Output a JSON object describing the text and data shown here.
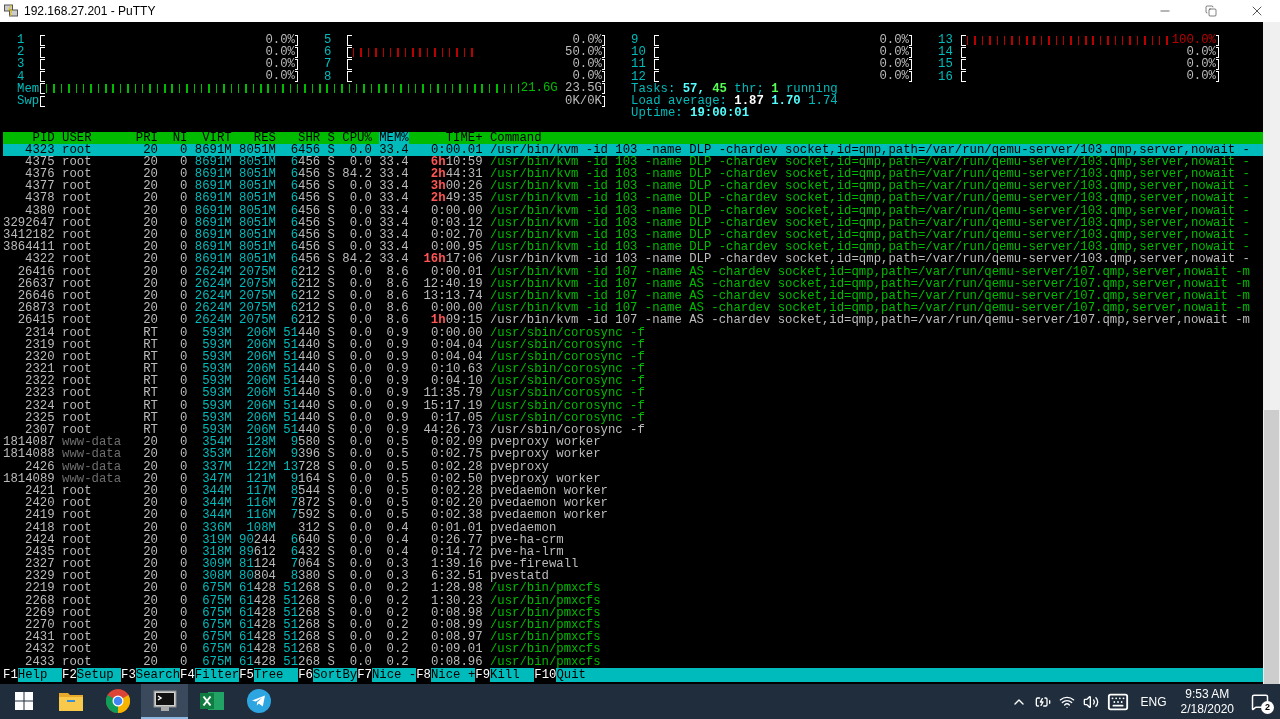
{
  "window": {
    "title": "192.168.27.201 - PuTTY"
  },
  "cpu_meters": [
    {
      "label": "1",
      "level": 0,
      "reading": "0.0%"
    },
    {
      "label": "2",
      "level": 0,
      "reading": "0.0%"
    },
    {
      "label": "3",
      "level": 0,
      "reading": "0.0%"
    },
    {
      "label": "4",
      "level": 0,
      "reading": "0.0%"
    },
    {
      "label": "5",
      "level": 0,
      "reading": "0.0%"
    },
    {
      "label": "6",
      "level": 0.5,
      "reading": "50.0%"
    },
    {
      "label": "7",
      "level": 0,
      "reading": "0.0%"
    },
    {
      "label": "8",
      "level": 0,
      "reading": "0.0%"
    },
    {
      "label": "9",
      "level": 0,
      "reading": "0.0%"
    },
    {
      "label": "10",
      "level": 0,
      "reading": "0.0%"
    },
    {
      "label": "11",
      "level": 0,
      "reading": "0.0%"
    },
    {
      "label": "12",
      "level": 0,
      "reading": "0.0%"
    },
    {
      "label": "13",
      "level": 1,
      "reading": "100.0%"
    },
    {
      "label": "14",
      "level": 0,
      "reading": "0.0%"
    },
    {
      "label": "15",
      "level": 0,
      "reading": "0.0%"
    },
    {
      "label": "16",
      "level": 0,
      "reading": "0.0%"
    }
  ],
  "memory": {
    "label": "Mem",
    "level": 0.92,
    "used": "21.6G",
    "total": "23.5G"
  },
  "swap": {
    "label": "Swp",
    "level": 0,
    "reading": "0K/0K"
  },
  "summary": [
    {
      "segments": [
        {
          "kind": "label",
          "text": "Tasks:"
        },
        {
          "kind": "bold",
          "text": "57,"
        },
        {
          "kind": "green",
          "text": "45"
        },
        {
          "kind": "label",
          "text": "thr;"
        },
        {
          "kind": "green",
          "text": "1"
        },
        {
          "kind": "label",
          "text": "running"
        }
      ]
    },
    {
      "segments": [
        {
          "kind": "label",
          "text": "Load average:"
        },
        {
          "kind": "white",
          "text": "1.87"
        },
        {
          "kind": "bold",
          "text": "1.70"
        },
        {
          "kind": "label",
          "text": "1.74"
        }
      ]
    },
    {
      "segments": [
        {
          "kind": "label",
          "text": "Uptime:"
        },
        {
          "kind": "bold",
          "text": "19:00:01"
        }
      ]
    }
  ],
  "columns": [
    {
      "label": "PID",
      "selected": false
    },
    {
      "label": "USER",
      "selected": false
    },
    {
      "label": "PRI",
      "selected": false
    },
    {
      "label": "NI",
      "selected": false
    },
    {
      "label": "VIRT",
      "selected": false
    },
    {
      "label": "RES",
      "selected": false
    },
    {
      "label": "SHR",
      "selected": false
    },
    {
      "label": "S",
      "selected": false
    },
    {
      "label": "CPU%",
      "selected": false
    },
    {
      "label": "MEM%",
      "selected": true
    },
    {
      "label": "TIME+",
      "selected": false
    },
    {
      "label": "Command",
      "selected": false
    }
  ],
  "processes": [
    {
      "pid": "4323",
      "user": "root",
      "pri": "20",
      "ni": "0",
      "virt": "8691M",
      "res": "8051M",
      "shr": "6456",
      "state": "S",
      "cpu": "0.0",
      "mem": "33.4",
      "time": "0:00.01",
      "command": "/usr/bin/kvm -id 103 -name DLP -chardev socket,id=qmp,path=/var/run/qemu-server/103.qmp,server,nowait -",
      "selected": true
    },
    {
      "pid": "4375",
      "user": "root",
      "pri": "20",
      "ni": "0",
      "virt": "8691M",
      "res": "8051M",
      "shr": "6456",
      "state": "S",
      "cpu": "0.0",
      "mem": "33.4",
      "hours": "6h",
      "time": "10:59",
      "command": "/usr/bin/kvm -id 103 -name DLP -chardev socket,id=qmp,path=/var/run/qemu-server/103.qmp,server,nowait -",
      "selected": false,
      "thread": true,
      "user_dimmed": false
    },
    {
      "pid": "4376",
      "user": "root",
      "pri": "20",
      "ni": "0",
      "virt": "8691M",
      "res": "8051M",
      "shr": "6456",
      "state": "S",
      "cpu": "84.2",
      "mem": "33.4",
      "hours": "2h",
      "time": "44:31",
      "command": "/usr/bin/kvm -id 103 -name DLP -chardev socket,id=qmp,path=/var/run/qemu-server/103.qmp,server,nowait -",
      "selected": false,
      "thread": true,
      "user_dimmed": false
    },
    {
      "pid": "4377",
      "user": "root",
      "pri": "20",
      "ni": "0",
      "virt": "8691M",
      "res": "8051M",
      "shr": "6456",
      "state": "S",
      "cpu": "0.0",
      "mem": "33.4",
      "hours": "3h",
      "time": "00:26",
      "command": "/usr/bin/kvm -id 103 -name DLP -chardev socket,id=qmp,path=/var/run/qemu-server/103.qmp,server,nowait -",
      "selected": false,
      "thread": true,
      "user_dimmed": false
    },
    {
      "pid": "4378",
      "user": "root",
      "pri": "20",
      "ni": "0",
      "virt": "8691M",
      "res": "8051M",
      "shr": "6456",
      "state": "S",
      "cpu": "0.0",
      "mem": "33.4",
      "hours": "2h",
      "time": "49:35",
      "command": "/usr/bin/kvm -id 103 -name DLP -chardev socket,id=qmp,path=/var/run/qemu-server/103.qmp,server,nowait -",
      "selected": false,
      "thread": true,
      "user_dimmed": false
    },
    {
      "pid": "4380",
      "user": "root",
      "pri": "20",
      "ni": "0",
      "virt": "8691M",
      "res": "8051M",
      "shr": "6456",
      "state": "S",
      "cpu": "0.0",
      "mem": "33.4",
      "time": "0:00.00",
      "command": "/usr/bin/kvm -id 103 -name DLP -chardev socket,id=qmp,path=/var/run/qemu-server/103.qmp,server,nowait -",
      "selected": false,
      "thread": true,
      "user_dimmed": false
    },
    {
      "pid": "3292647",
      "user": "root",
      "pri": "20",
      "ni": "0",
      "virt": "8691M",
      "res": "8051M",
      "shr": "6456",
      "state": "S",
      "cpu": "0.0",
      "mem": "33.4",
      "time": "0:03.12",
      "command": "/usr/bin/kvm -id 103 -name DLP -chardev socket,id=qmp,path=/var/run/qemu-server/103.qmp,server,nowait -",
      "selected": false,
      "thread": true,
      "user_dimmed": false
    },
    {
      "pid": "3412182",
      "user": "root",
      "pri": "20",
      "ni": "0",
      "virt": "8691M",
      "res": "8051M",
      "shr": "6456",
      "state": "S",
      "cpu": "0.0",
      "mem": "33.4",
      "time": "0:02.70",
      "command": "/usr/bin/kvm -id 103 -name DLP -chardev socket,id=qmp,path=/var/run/qemu-server/103.qmp,server,nowait -",
      "selected": false,
      "thread": true,
      "user_dimmed": false
    },
    {
      "pid": "3864411",
      "user": "root",
      "pri": "20",
      "ni": "0",
      "virt": "8691M",
      "res": "8051M",
      "shr": "6456",
      "state": "S",
      "cpu": "0.0",
      "mem": "33.4",
      "time": "0:00.95",
      "command": "/usr/bin/kvm -id 103 -name DLP -chardev socket,id=qmp,path=/var/run/qemu-server/103.qmp,server,nowait -",
      "selected": false,
      "thread": true,
      "user_dimmed": false
    },
    {
      "pid": "4322",
      "user": "root",
      "pri": "20",
      "ni": "0",
      "virt": "8691M",
      "res": "8051M",
      "shr": "6456",
      "state": "S",
      "cpu": "84.2",
      "mem": "33.4",
      "hours": "16h",
      "time": "17:06",
      "command": "/usr/bin/kvm -id 103 -name DLP -chardev socket,id=qmp,path=/var/run/qemu-server/103.qmp,server,nowait -",
      "selected": false,
      "thread": false,
      "user_dimmed": false
    },
    {
      "pid": "26416",
      "user": "root",
      "pri": "20",
      "ni": "0",
      "virt": "2624M",
      "res": "2075M",
      "shr": "6212",
      "state": "S",
      "cpu": "0.0",
      "mem": "8.6",
      "time": "0:00.01",
      "command": "/usr/bin/kvm -id 107 -name AS -chardev socket,id=qmp,path=/var/run/qemu-server/107.qmp,server,nowait -m",
      "selected": false,
      "thread": true,
      "user_dimmed": false
    },
    {
      "pid": "26637",
      "user": "root",
      "pri": "20",
      "ni": "0",
      "virt": "2624M",
      "res": "2075M",
      "shr": "6212",
      "state": "S",
      "cpu": "0.0",
      "mem": "8.6",
      "time": "12:40.19",
      "command": "/usr/bin/kvm -id 107 -name AS -chardev socket,id=qmp,path=/var/run/qemu-server/107.qmp,server,nowait -m",
      "selected": false,
      "thread": true,
      "user_dimmed": false
    },
    {
      "pid": "26646",
      "user": "root",
      "pri": "20",
      "ni": "0",
      "virt": "2624M",
      "res": "2075M",
      "shr": "6212",
      "state": "S",
      "cpu": "0.0",
      "mem": "8.6",
      "time": "13:13.74",
      "command": "/usr/bin/kvm -id 107 -name AS -chardev socket,id=qmp,path=/var/run/qemu-server/107.qmp,server,nowait -m",
      "selected": false,
      "thread": true,
      "user_dimmed": false
    },
    {
      "pid": "26873",
      "user": "root",
      "pri": "20",
      "ni": "0",
      "virt": "2624M",
      "res": "2075M",
      "shr": "6212",
      "state": "S",
      "cpu": "0.0",
      "mem": "8.6",
      "time": "0:00.00",
      "command": "/usr/bin/kvm -id 107 -name AS -chardev socket,id=qmp,path=/var/run/qemu-server/107.qmp,server,nowait -m",
      "selected": false,
      "thread": true,
      "user_dimmed": false
    },
    {
      "pid": "26415",
      "user": "root",
      "pri": "20",
      "ni": "0",
      "virt": "2624M",
      "res": "2075M",
      "shr": "6212",
      "state": "S",
      "cpu": "0.0",
      "mem": "8.6",
      "hours": "1h",
      "time": "09:15",
      "command": "/usr/bin/kvm -id 107 -name AS -chardev socket,id=qmp,path=/var/run/qemu-server/107.qmp,server,nowait -m",
      "selected": false,
      "thread": false,
      "user_dimmed": false
    },
    {
      "pid": "2314",
      "user": "root",
      "pri": "RT",
      "ni": "0",
      "virt": "593M",
      "res": "206M",
      "shr": "51440",
      "state": "S",
      "cpu": "0.0",
      "mem": "0.9",
      "time": "0:00.00",
      "command": "/usr/sbin/corosync -f",
      "selected": false,
      "thread": true,
      "user_dimmed": false
    },
    {
      "pid": "2319",
      "user": "root",
      "pri": "RT",
      "ni": "0",
      "virt": "593M",
      "res": "206M",
      "shr": "51440",
      "state": "S",
      "cpu": "0.0",
      "mem": "0.9",
      "time": "0:04.04",
      "command": "/usr/sbin/corosync -f",
      "selected": false,
      "thread": true,
      "user_dimmed": false
    },
    {
      "pid": "2320",
      "user": "root",
      "pri": "RT",
      "ni": "0",
      "virt": "593M",
      "res": "206M",
      "shr": "51440",
      "state": "S",
      "cpu": "0.0",
      "mem": "0.9",
      "time": "0:04.04",
      "command": "/usr/sbin/corosync -f",
      "selected": false,
      "thread": true,
      "user_dimmed": false
    },
    {
      "pid": "2321",
      "user": "root",
      "pri": "RT",
      "ni": "0",
      "virt": "593M",
      "res": "206M",
      "shr": "51440",
      "state": "S",
      "cpu": "0.0",
      "mem": "0.9",
      "time": "0:10.63",
      "command": "/usr/sbin/corosync -f",
      "selected": false,
      "thread": true,
      "user_dimmed": false
    },
    {
      "pid": "2322",
      "user": "root",
      "pri": "RT",
      "ni": "0",
      "virt": "593M",
      "res": "206M",
      "shr": "51440",
      "state": "S",
      "cpu": "0.0",
      "mem": "0.9",
      "time": "0:04.10",
      "command": "/usr/sbin/corosync -f",
      "selected": false,
      "thread": true,
      "user_dimmed": false
    },
    {
      "pid": "2323",
      "user": "root",
      "pri": "RT",
      "ni": "0",
      "virt": "593M",
      "res": "206M",
      "shr": "51440",
      "state": "S",
      "cpu": "0.0",
      "mem": "0.9",
      "time": "11:35.79",
      "command": "/usr/sbin/corosync -f",
      "selected": false,
      "thread": true,
      "user_dimmed": false
    },
    {
      "pid": "2324",
      "user": "root",
      "pri": "RT",
      "ni": "0",
      "virt": "593M",
      "res": "206M",
      "shr": "51440",
      "state": "S",
      "cpu": "0.0",
      "mem": "0.9",
      "time": "15:17.19",
      "command": "/usr/sbin/corosync -f",
      "selected": false,
      "thread": true,
      "user_dimmed": false
    },
    {
      "pid": "2325",
      "user": "root",
      "pri": "RT",
      "ni": "0",
      "virt": "593M",
      "res": "206M",
      "shr": "51440",
      "state": "S",
      "cpu": "0.0",
      "mem": "0.9",
      "time": "0:17.05",
      "command": "/usr/sbin/corosync -f",
      "selected": false,
      "thread": true,
      "user_dimmed": false
    },
    {
      "pid": "2307",
      "user": "root",
      "pri": "RT",
      "ni": "0",
      "virt": "593M",
      "res": "206M",
      "shr": "51440",
      "state": "S",
      "cpu": "0.0",
      "mem": "0.9",
      "time": "44:26.73",
      "command": "/usr/sbin/corosync -f",
      "selected": false,
      "thread": false,
      "user_dimmed": false
    },
    {
      "pid": "1814087",
      "user": "www-data",
      "pri": "20",
      "ni": "0",
      "virt": "354M",
      "res": "128M",
      "shr": "9580",
      "state": "S",
      "cpu": "0.0",
      "mem": "0.5",
      "time": "0:02.09",
      "command": "pveproxy worker",
      "selected": false,
      "thread": false,
      "user_dimmed": true
    },
    {
      "pid": "1814088",
      "user": "www-data",
      "pri": "20",
      "ni": "0",
      "virt": "353M",
      "res": "126M",
      "shr": "9396",
      "state": "S",
      "cpu": "0.0",
      "mem": "0.5",
      "time": "0:02.75",
      "command": "pveproxy worker",
      "selected": false,
      "thread": false,
      "user_dimmed": true
    },
    {
      "pid": "2426",
      "user": "www-data",
      "pri": "20",
      "ni": "0",
      "virt": "337M",
      "res": "122M",
      "shr": "13728",
      "state": "S",
      "cpu": "0.0",
      "mem": "0.5",
      "time": "0:02.28",
      "command": "pveproxy",
      "selected": false,
      "thread": false,
      "user_dimmed": true
    },
    {
      "pid": "1814089",
      "user": "www-data",
      "pri": "20",
      "ni": "0",
      "virt": "347M",
      "res": "121M",
      "shr": "9164",
      "state": "S",
      "cpu": "0.0",
      "mem": "0.5",
      "time": "0:02.50",
      "command": "pveproxy worker",
      "selected": false,
      "thread": false,
      "user_dimmed": true
    },
    {
      "pid": "2421",
      "user": "root",
      "pri": "20",
      "ni": "0",
      "virt": "344M",
      "res": "117M",
      "shr": "8544",
      "state": "S",
      "cpu": "0.0",
      "mem": "0.5",
      "time": "0:02.28",
      "command": "pvedaemon worker",
      "selected": false,
      "thread": false,
      "user_dimmed": false
    },
    {
      "pid": "2420",
      "user": "root",
      "pri": "20",
      "ni": "0",
      "virt": "344M",
      "res": "116M",
      "shr": "7872",
      "state": "S",
      "cpu": "0.0",
      "mem": "0.5",
      "time": "0:02.20",
      "command": "pvedaemon worker",
      "selected": false,
      "thread": false,
      "user_dimmed": false
    },
    {
      "pid": "2419",
      "user": "root",
      "pri": "20",
      "ni": "0",
      "virt": "344M",
      "res": "116M",
      "shr": "7592",
      "state": "S",
      "cpu": "0.0",
      "mem": "0.5",
      "time": "0:02.38",
      "command": "pvedaemon worker",
      "selected": false,
      "thread": false,
      "user_dimmed": false
    },
    {
      "pid": "2418",
      "user": "root",
      "pri": "20",
      "ni": "0",
      "virt": "336M",
      "res": "108M",
      "shr": "312",
      "state": "S",
      "cpu": "0.0",
      "mem": "0.4",
      "time": "0:01.01",
      "command": "pvedaemon",
      "selected": false,
      "thread": false,
      "user_dimmed": false
    },
    {
      "pid": "2424",
      "user": "root",
      "pri": "20",
      "ni": "0",
      "virt": "319M",
      "res": "90244",
      "shr": "6640",
      "state": "S",
      "cpu": "0.0",
      "mem": "0.4",
      "time": "0:26.77",
      "command": "pve-ha-crm",
      "selected": false,
      "thread": false,
      "user_dimmed": false
    },
    {
      "pid": "2435",
      "user": "root",
      "pri": "20",
      "ni": "0",
      "virt": "318M",
      "res": "89612",
      "shr": "6432",
      "state": "S",
      "cpu": "0.0",
      "mem": "0.4",
      "time": "0:14.72",
      "command": "pve-ha-lrm",
      "selected": false,
      "thread": false,
      "user_dimmed": false
    },
    {
      "pid": "2327",
      "user": "root",
      "pri": "20",
      "ni": "0",
      "virt": "309M",
      "res": "81124",
      "shr": "7064",
      "state": "S",
      "cpu": "0.0",
      "mem": "0.3",
      "time": "1:39.16",
      "command": "pve-firewall",
      "selected": false,
      "thread": false,
      "user_dimmed": false
    },
    {
      "pid": "2329",
      "user": "root",
      "pri": "20",
      "ni": "0",
      "virt": "308M",
      "res": "80804",
      "shr": "8380",
      "state": "S",
      "cpu": "0.0",
      "mem": "0.3",
      "time": "6:32.51",
      "command": "pvestatd",
      "selected": false,
      "thread": false,
      "user_dimmed": false
    },
    {
      "pid": "2219",
      "user": "root",
      "pri": "20",
      "ni": "0",
      "virt": "675M",
      "res": "61428",
      "shr": "51268",
      "state": "S",
      "cpu": "0.0",
      "mem": "0.2",
      "time": "1:28.98",
      "command": "/usr/bin/pmxcfs",
      "selected": false,
      "thread": true,
      "user_dimmed": false
    },
    {
      "pid": "2268",
      "user": "root",
      "pri": "20",
      "ni": "0",
      "virt": "675M",
      "res": "61428",
      "shr": "51268",
      "state": "S",
      "cpu": "0.0",
      "mem": "0.2",
      "time": "1:30.23",
      "command": "/usr/bin/pmxcfs",
      "selected": false,
      "thread": true,
      "user_dimmed": false
    },
    {
      "pid": "2269",
      "user": "root",
      "pri": "20",
      "ni": "0",
      "virt": "675M",
      "res": "61428",
      "shr": "51268",
      "state": "S",
      "cpu": "0.0",
      "mem": "0.2",
      "time": "0:08.98",
      "command": "/usr/bin/pmxcfs",
      "selected": false,
      "thread": true,
      "user_dimmed": false
    },
    {
      "pid": "2270",
      "user": "root",
      "pri": "20",
      "ni": "0",
      "virt": "675M",
      "res": "61428",
      "shr": "51268",
      "state": "S",
      "cpu": "0.0",
      "mem": "0.2",
      "time": "0:08.99",
      "command": "/usr/bin/pmxcfs",
      "selected": false,
      "thread": true,
      "user_dimmed": false
    },
    {
      "pid": "2431",
      "user": "root",
      "pri": "20",
      "ni": "0",
      "virt": "675M",
      "res": "61428",
      "shr": "51268",
      "state": "S",
      "cpu": "0.0",
      "mem": "0.2",
      "time": "0:08.97",
      "command": "/usr/bin/pmxcfs",
      "selected": false,
      "thread": true,
      "user_dimmed": false
    },
    {
      "pid": "2432",
      "user": "root",
      "pri": "20",
      "ni": "0",
      "virt": "675M",
      "res": "61428",
      "shr": "51268",
      "state": "S",
      "cpu": "0.0",
      "mem": "0.2",
      "time": "0:09.01",
      "command": "/usr/bin/pmxcfs",
      "selected": false,
      "thread": true,
      "user_dimmed": false
    },
    {
      "pid": "2433",
      "user": "root",
      "pri": "20",
      "ni": "0",
      "virt": "675M",
      "res": "61428",
      "shr": "51268",
      "state": "S",
      "cpu": "0.0",
      "mem": "0.2",
      "time": "0:08.96",
      "command": "/usr/bin/pmxcfs",
      "selected": false,
      "thread": true,
      "user_dimmed": false
    }
  ],
  "function_keys": [
    {
      "key": "F1",
      "label": "Help"
    },
    {
      "key": "F2",
      "label": "Setup"
    },
    {
      "key": "F3",
      "label": "Search"
    },
    {
      "key": "F4",
      "label": "Filter"
    },
    {
      "key": "F5",
      "label": "Tree"
    },
    {
      "key": "F6",
      "label": "SortBy"
    },
    {
      "key": "F7",
      "label": "Nice -"
    },
    {
      "key": "F8",
      "label": "Nice +"
    },
    {
      "key": "F9",
      "label": "Kill"
    },
    {
      "key": "F10",
      "label": "Quit"
    }
  ],
  "taskbar": {
    "apps": [
      {
        "kind": "start",
        "selected": false
      },
      {
        "kind": "folder",
        "selected": false
      },
      {
        "kind": "browser",
        "selected": false
      },
      {
        "kind": "terminal",
        "selected": true
      },
      {
        "kind": "spreadsheet",
        "selected": false
      },
      {
        "kind": "messenger",
        "selected": false
      }
    ],
    "tray": {
      "language": "ENG",
      "time": "9:53 AM",
      "date": "2/18/2020",
      "notification_count": "2"
    }
  }
}
